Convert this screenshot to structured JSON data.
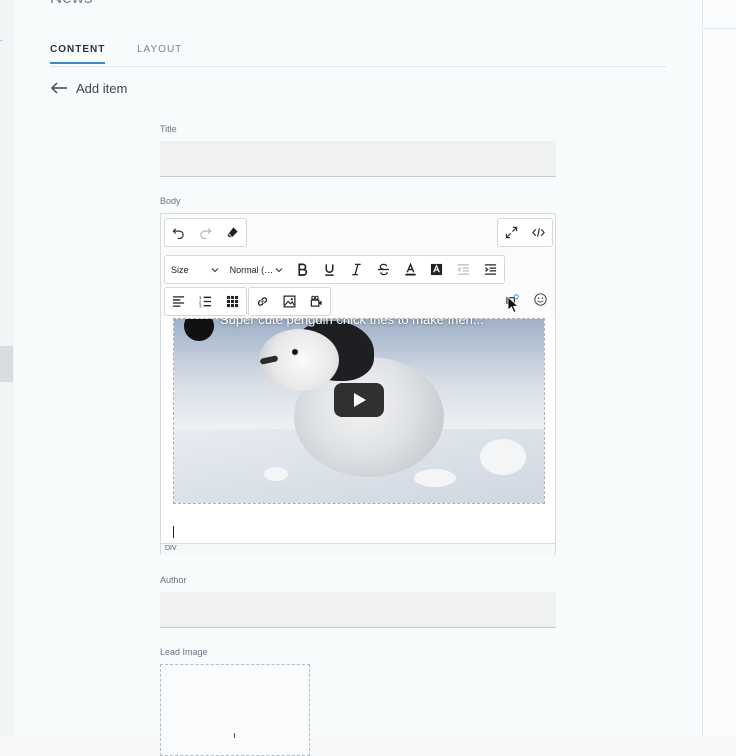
{
  "page": {
    "title": "News"
  },
  "tabs": [
    {
      "label": "CONTENT"
    },
    {
      "label": "LAYOUT"
    }
  ],
  "back": {
    "label": "Add item"
  },
  "fields": {
    "title": {
      "label": "Title",
      "value": ""
    },
    "body": {
      "label": "Body"
    },
    "author": {
      "label": "Author",
      "value": ""
    },
    "lead_image": {
      "label": "Lead Image"
    }
  },
  "toolbar": {
    "size_label": "Size",
    "format_label": "Normal (…"
  },
  "video": {
    "title": "Super cute penguin chick tries to make frien..."
  },
  "statusbar": {
    "path": "DIV"
  },
  "icons": {
    "undo": "undo-icon",
    "redo": "redo-icon",
    "eraser": "eraser-icon",
    "fullscreen": "fullscreen-icon",
    "code": "code-icon",
    "bold": "bold-icon",
    "underline": "underline-icon",
    "italic": "italic-icon",
    "strike": "strikethrough-icon",
    "font_color": "font-color-icon",
    "bg_color": "highlight-icon",
    "outdent": "outdent-icon",
    "indent": "indent-icon",
    "align": "align-left-icon",
    "ol": "ordered-list-icon",
    "table": "table-icon",
    "link": "link-icon",
    "image": "image-icon",
    "video": "video-icon",
    "emoticon": "smile-icon"
  }
}
